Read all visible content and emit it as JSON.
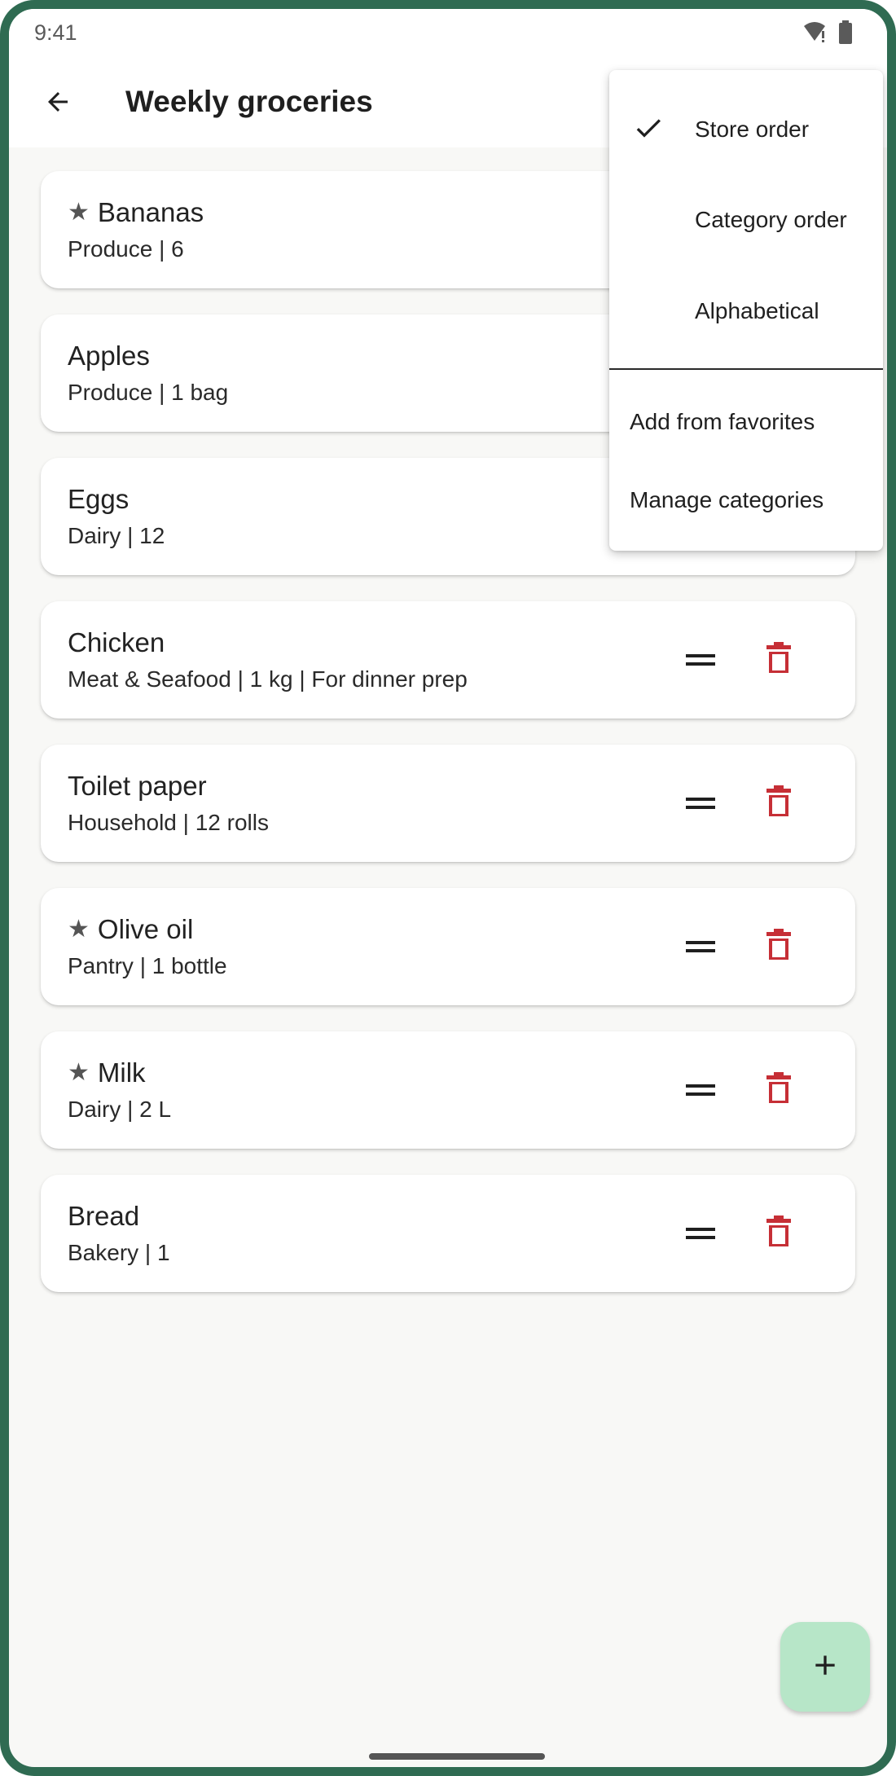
{
  "status_bar": {
    "time": "9:41",
    "icons": [
      "wifi-alert-icon",
      "battery-icon"
    ]
  },
  "app_bar": {
    "back_icon": "arrow-back-icon",
    "title": "Weekly groceries"
  },
  "items": [
    {
      "name": "Bananas",
      "favorite": true,
      "detail": "Produce | 6"
    },
    {
      "name": "Apples",
      "favorite": false,
      "detail": "Produce | 1 bag"
    },
    {
      "name": "Eggs",
      "favorite": false,
      "detail": "Dairy | 12"
    },
    {
      "name": "Chicken",
      "favorite": false,
      "detail": "Meat & Seafood | 1 kg | For dinner prep"
    },
    {
      "name": "Toilet paper",
      "favorite": false,
      "detail": "Household | 12 rolls"
    },
    {
      "name": "Olive oil",
      "favorite": true,
      "detail": "Pantry | 1 bottle"
    },
    {
      "name": "Milk",
      "favorite": true,
      "detail": "Dairy | 2 L"
    },
    {
      "name": "Bread",
      "favorite": false,
      "detail": "Bakery | 1"
    }
  ],
  "sort_menu": {
    "options": [
      {
        "label": "Store order",
        "checked": true
      },
      {
        "label": "Category order",
        "checked": false
      },
      {
        "label": "Alphabetical",
        "checked": false
      }
    ],
    "actions": [
      {
        "label": "Add from favorites"
      },
      {
        "label": "Manage categories"
      }
    ]
  },
  "fab": {
    "icon": "plus-icon"
  },
  "colors": {
    "frame": "#2f6b52",
    "background": "#f8f8f6",
    "delete": "#c62f36",
    "fab": "#b7e6c8"
  }
}
